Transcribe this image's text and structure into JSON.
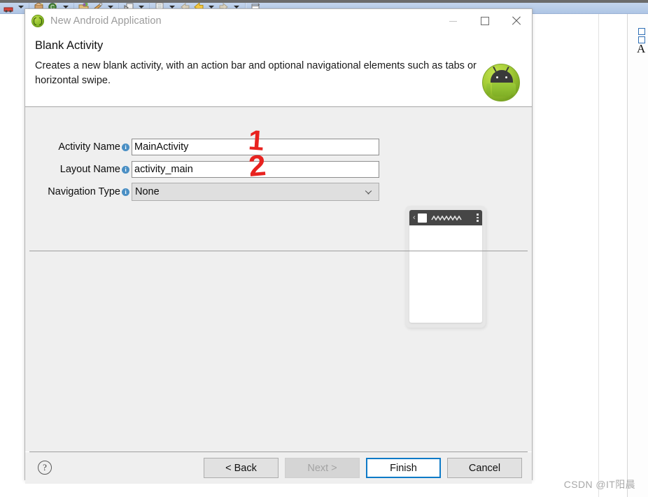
{
  "background": {
    "toolbar_icons": [
      "save-icon",
      "dropdown-arrow-icon",
      "new-package-icon",
      "new-class-icon",
      "dropdown-arrow-icon",
      "open-type-icon",
      "dropdown-arrow-icon",
      "run-icon",
      "dropdown-arrow-icon",
      "debug-icon",
      "dropdown-arrow-icon",
      "external-tools-icon",
      "dropdown-arrow-icon",
      "back-icon",
      "forward-icon",
      "dropdown-arrow-icon",
      "next-annotation-icon",
      "dropdown-arrow-icon",
      "new-window-icon"
    ],
    "panel_buttons": [
      "minimize-icon",
      "maximize-icon"
    ],
    "right_strip_letter": "A"
  },
  "dialog": {
    "title": "New Android Application",
    "title_icon": "android-wizard-icon",
    "window_controls": {
      "minimize": "minimize-icon",
      "maximize": "maximize-icon",
      "close": "close-icon"
    },
    "header": {
      "title": "Blank Activity",
      "description": "Creates a new blank activity, with an action bar and optional navigational elements such as tabs or horizontal swipe.",
      "robot_icon": "android-robot-icon"
    },
    "form": {
      "fields": [
        {
          "label": "Activity Name",
          "info_icon": "info-icon",
          "type": "text",
          "value": "MainActivity",
          "name": "activity-name-input"
        },
        {
          "label": "Layout Name",
          "info_icon": "info-icon",
          "type": "text",
          "value": "activity_main",
          "name": "layout-name-input"
        },
        {
          "label": "Navigation Type",
          "info_icon": "info-icon",
          "type": "combo",
          "value": "None",
          "name": "navigation-type-combo"
        }
      ]
    },
    "preview": {
      "label": "phone-preview",
      "back_glyph": "‹",
      "app_icon": "app-icon",
      "overflow_icon": "overflow-menu-icon"
    },
    "footer": {
      "help_icon": "?",
      "buttons": [
        {
          "label": "< Back",
          "name": "back-button",
          "state": "enabled"
        },
        {
          "label": "Next >",
          "name": "next-button",
          "state": "disabled"
        },
        {
          "label": "Finish",
          "name": "finish-button",
          "state": "primary"
        },
        {
          "label": "Cancel",
          "name": "cancel-button",
          "state": "enabled"
        }
      ]
    }
  },
  "annotations": [
    {
      "text": "1",
      "name": "annotation-one",
      "color": "#e8221f"
    },
    {
      "text": "2",
      "name": "annotation-two",
      "color": "#e8221f"
    }
  ],
  "watermark": {
    "text": "CSDN @IT阳晨"
  }
}
